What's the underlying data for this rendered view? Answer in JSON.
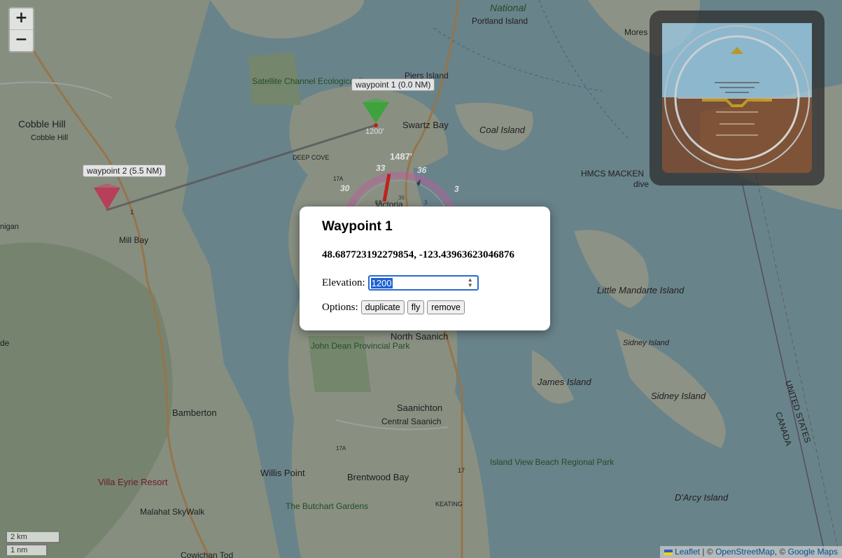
{
  "map": {
    "labels": {
      "national": "National",
      "portland_island": "Portland Island",
      "moresby": "Mores",
      "piers_island": "Piers Island",
      "satellite_channel": "Satellite Channel Ecological Reserve",
      "cobble_hill_big": "Cobble Hill",
      "cobble_hill_small": "Cobble Hill",
      "swartz_bay": "Swartz Bay",
      "coal_island": "Coal Island",
      "deep_cove": "DEEP COVE",
      "hmcs": "HMCS MACKEN",
      "dive": "dive",
      "mill_bay": "Mill Bay",
      "nigan": "nigan",
      "little_mandarte": "Little Mandarte Island",
      "north_saanich": "North Saanich",
      "john_dean": "John Dean Provincial Park",
      "sidney_island_small": "Sidney Island",
      "james_island": "James Island",
      "sidney_island": "Sidney Island",
      "bamberton": "Bamberton",
      "saanichton": "Saanichton",
      "central_saanich": "Central Saanich",
      "united_states": "UNITED STATES",
      "canada": "CANADA",
      "island_view": "Island View Beach Regional Park",
      "willis_point": "Willis Point",
      "brentwood_bay": "Brentwood Bay",
      "keating": "KEATING",
      "villa_eyrie": "Villa Eyrie Resort",
      "butchart": "The Butchart Gardens",
      "malahat": "Malahat SkyWalk",
      "darcy": "D'Arcy Island",
      "cowichan": "Cowichan Tod",
      "route_17a": "17A",
      "route_17": "17",
      "victoria": "Victoria",
      "de": "de",
      "route_1": "1"
    },
    "waypoints": [
      {
        "label": "waypoint 1 (0.0 NM)",
        "elevation_text": "1200'",
        "color": "#1e9a1e"
      },
      {
        "label": "waypoint 2 (5.5 NM)",
        "elevation_text": "",
        "color": "#b0143a"
      }
    ],
    "aircraft": {
      "altitude_text": "1487'",
      "heading_labels": [
        "30",
        "33",
        "36",
        "3"
      ],
      "inner_labels": [
        "33",
        "36",
        "3"
      ]
    }
  },
  "zoom": {
    "in": "+",
    "out": "−"
  },
  "scale": {
    "km": "2 km",
    "nm": "1 nm"
  },
  "attribution": {
    "leaflet": "Leaflet",
    "sep1": " | © ",
    "osm": "OpenStreetMap",
    "sep2": ", © ",
    "google": "Google Maps"
  },
  "popup": {
    "title": "Waypoint 1",
    "coords": "48.687723192279854, -123.43963623046876",
    "elevation_label": "Elevation:",
    "elevation_value": "1200",
    "options_label": "Options:",
    "buttons": {
      "duplicate": "duplicate",
      "fly": "fly",
      "remove": "remove"
    }
  },
  "attitude_indicator": {
    "sky_color": "#4a8fc3",
    "ground_color": "#8a4a22"
  }
}
